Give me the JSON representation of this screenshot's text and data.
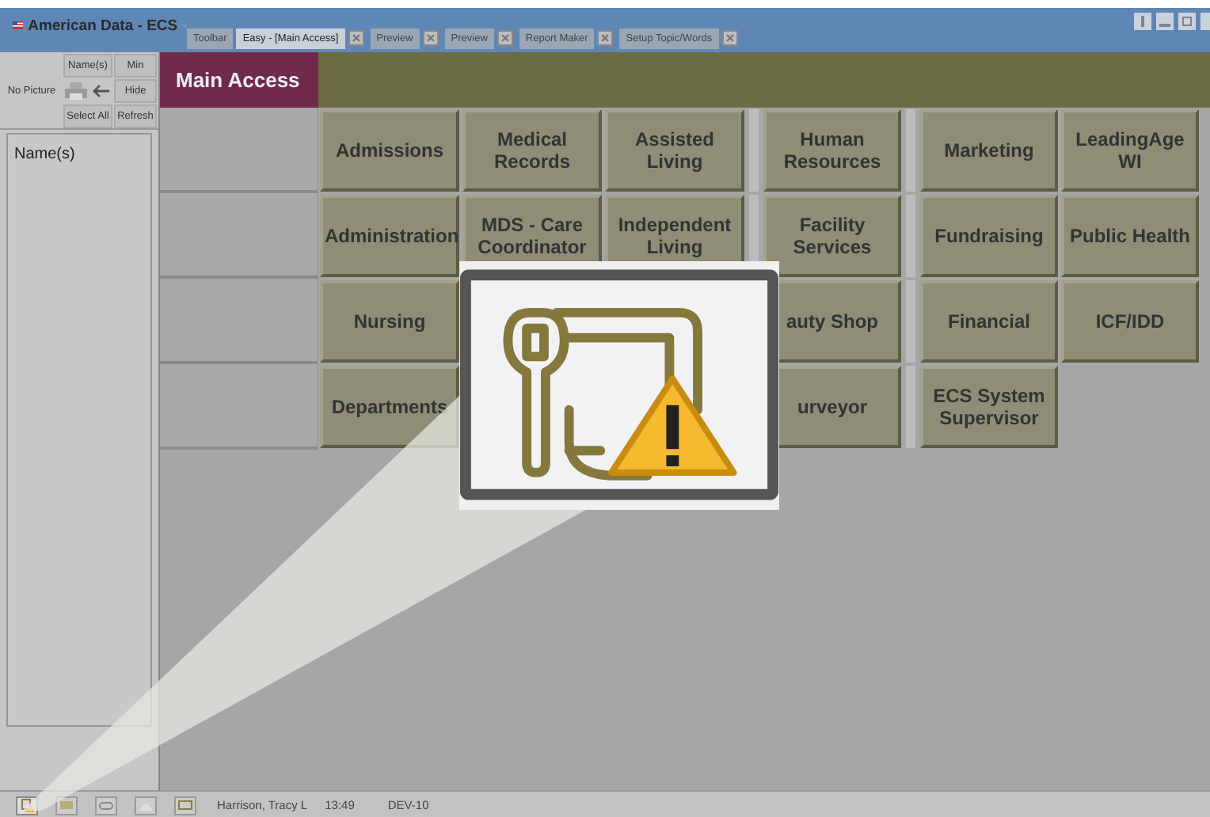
{
  "window": {
    "title": "American Data - ECS"
  },
  "tabs": [
    {
      "label": "Toolbar",
      "selected": false,
      "closable": false
    },
    {
      "label": "Easy - [Main Access]",
      "selected": true,
      "closable": true
    },
    {
      "label": "Preview",
      "selected": false,
      "closable": true
    },
    {
      "label": "Preview",
      "selected": false,
      "closable": true
    },
    {
      "label": "Report Maker",
      "selected": false,
      "closable": true
    },
    {
      "label": "Setup Topic/Words",
      "selected": false,
      "closable": true
    }
  ],
  "sidebar": {
    "no_picture": "No Picture",
    "names_button": "Name(s)",
    "min_button": "Min",
    "hide_button": "Hide",
    "select_all_button": "Select All",
    "refresh_button": "Refresh",
    "list_label": "Name(s)"
  },
  "header": {
    "title": "Main Access"
  },
  "grid": [
    [
      {
        "kind": "button",
        "label": "Admissions"
      },
      {
        "kind": "button",
        "label": "Medical Records"
      },
      {
        "kind": "button",
        "label": "Assisted Living"
      },
      {
        "kind": "button",
        "label": "Human Resources"
      },
      {
        "kind": "button",
        "label": "Marketing"
      },
      {
        "kind": "button",
        "label": "LeadingAge WI"
      }
    ],
    [
      {
        "kind": "button",
        "label": "Administration"
      },
      {
        "kind": "button",
        "label": "MDS - Care Coordinator"
      },
      {
        "kind": "button",
        "label": "Independent Living"
      },
      {
        "kind": "button",
        "label": "Facility Services"
      },
      {
        "kind": "button",
        "label": "Fundraising"
      },
      {
        "kind": "button",
        "label": "Public Health"
      }
    ],
    [
      {
        "kind": "button",
        "label": "Nursing"
      },
      {
        "kind": "covered"
      },
      {
        "kind": "covered"
      },
      {
        "kind": "button",
        "label": "auty Shop"
      },
      {
        "kind": "button",
        "label": "Financial"
      },
      {
        "kind": "button",
        "label": "ICF/IDD"
      }
    ],
    [
      {
        "kind": "button",
        "label": "Departments"
      },
      {
        "kind": "covered"
      },
      {
        "kind": "covered"
      },
      {
        "kind": "button",
        "label": "urveyor"
      },
      {
        "kind": "button",
        "label": "ECS System Supervisor"
      },
      {
        "kind": "empty"
      }
    ]
  ],
  "status_bar": {
    "user": "Harrison, Tracy L",
    "time": "13:49",
    "database": "DEV-10"
  }
}
